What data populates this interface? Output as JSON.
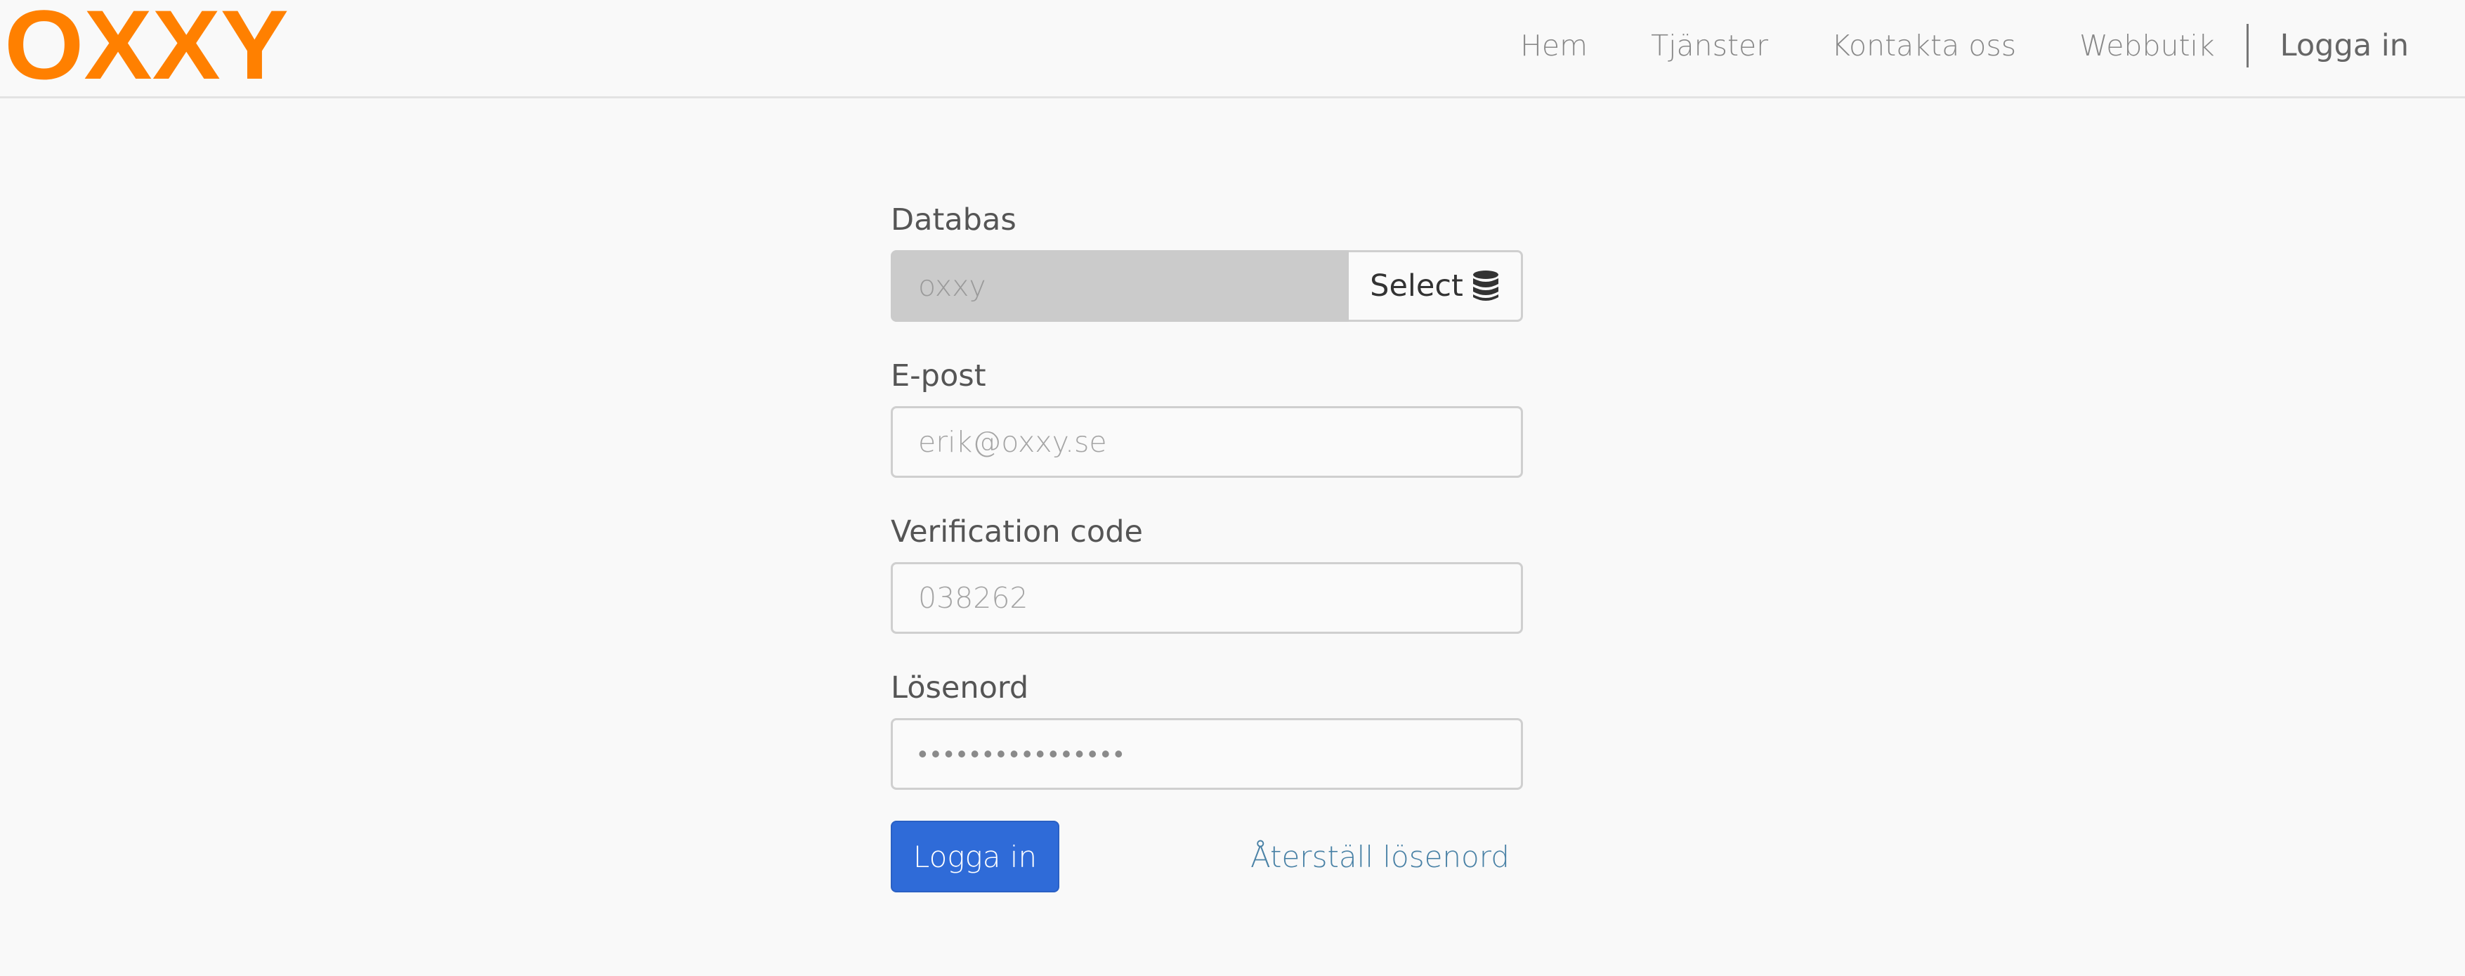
{
  "brand": {
    "logo_text": "OXXY",
    "logo_color": "#ff8000"
  },
  "nav": {
    "items": [
      {
        "label": "Hem"
      },
      {
        "label": "Tjänster"
      },
      {
        "label": "Kontakta oss"
      },
      {
        "label": "Webbutik"
      }
    ],
    "login_label": "Logga in"
  },
  "form": {
    "database": {
      "label": "Databas",
      "value": "oxxy",
      "select_label": "Select",
      "select_icon": "database-icon"
    },
    "email": {
      "label": "E-post",
      "value": "erik@oxxy.se"
    },
    "verification": {
      "label": "Verification code",
      "value": "038262"
    },
    "password": {
      "label": "Lösenord",
      "value": "••••••••••••••••"
    },
    "submit_label": "Logga in",
    "reset_label": "Återställ lösenord"
  },
  "colors": {
    "primary_button": "#2f6bd8",
    "link": "#4a82a6",
    "background": "#f9f9f9"
  }
}
